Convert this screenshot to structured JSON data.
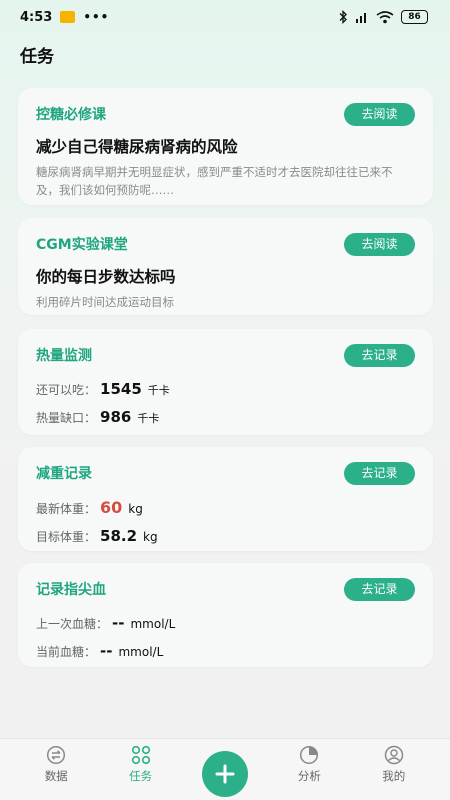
{
  "status_bar": {
    "time": "4:53",
    "dots": "•••",
    "network": "HD",
    "battery": "86"
  },
  "page": {
    "title": "任务"
  },
  "cards": {
    "course1": {
      "title": "控糖必修课",
      "button": "去阅读",
      "heading": "减少自己得糖尿病肾病的风险",
      "desc": "糖尿病肾病早期并无明显症状，感到严重不适时才去医院却往往已来不及，我们该如何预防呢……"
    },
    "course2": {
      "title": "CGM实验课堂",
      "button": "去阅读",
      "heading": "你的每日步数达标吗",
      "desc": "利用碎片时间达成运动目标"
    },
    "calorie": {
      "title": "热量监测",
      "button": "去记录",
      "rows": [
        {
          "label": "还可以吃：",
          "value": "1545",
          "unit": "千卡"
        },
        {
          "label": "热量缺口：",
          "value": "986",
          "unit": "千卡"
        }
      ]
    },
    "weight": {
      "title": "减重记录",
      "button": "去记录",
      "rows": [
        {
          "label": "最新体重：",
          "value": "60",
          "unit": "kg"
        },
        {
          "label": "目标体重：",
          "value": "58.2",
          "unit": "kg"
        }
      ]
    },
    "glucose": {
      "title": "记录指尖血",
      "button": "去记录",
      "rows": [
        {
          "label": "上一次血糖：",
          "value": "--",
          "unit": "mmol/L"
        },
        {
          "label": "当前血糖：",
          "value": "--",
          "unit": "mmol/L"
        }
      ]
    }
  },
  "tabbar": {
    "items": [
      {
        "label": "数据",
        "icon": "data-icon"
      },
      {
        "label": "任务",
        "icon": "task-icon"
      },
      {
        "label": "",
        "icon": "plus-icon"
      },
      {
        "label": "分析",
        "icon": "analysis-icon"
      },
      {
        "label": "我的",
        "icon": "profile-icon"
      }
    ]
  },
  "colors": {
    "accent": "#2bb089",
    "title_green": "#1fa680",
    "weight_red": "#d24f3f"
  }
}
